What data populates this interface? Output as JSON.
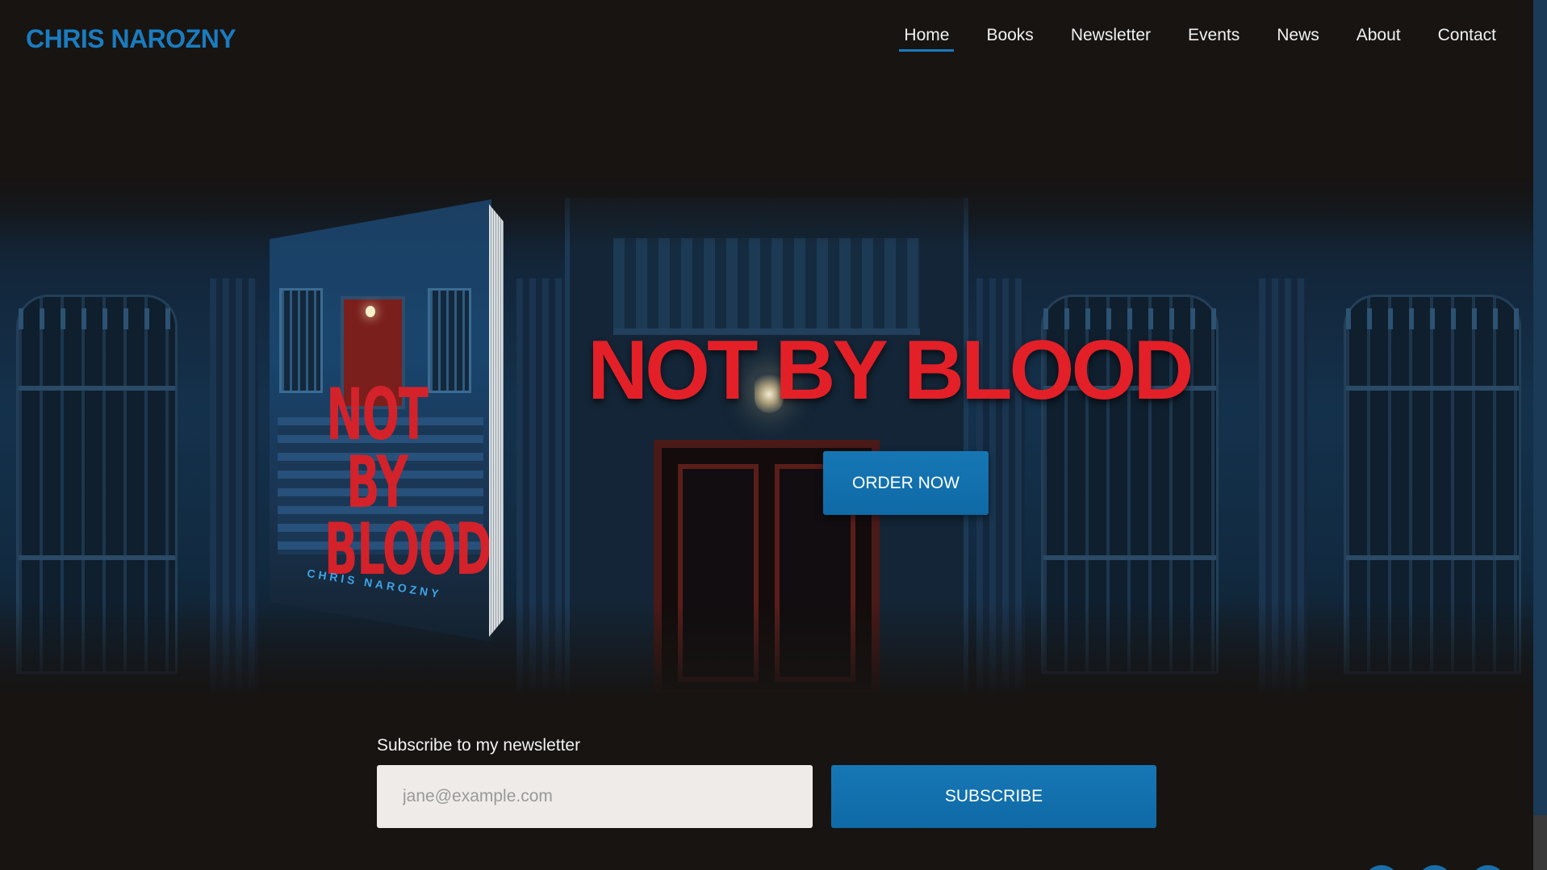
{
  "header": {
    "logo": "CHRIS NAROZNY",
    "nav": [
      {
        "label": "Home",
        "active": true
      },
      {
        "label": "Books"
      },
      {
        "label": "Newsletter"
      },
      {
        "label": "Events"
      },
      {
        "label": "News"
      },
      {
        "label": "About"
      },
      {
        "label": "Contact"
      }
    ]
  },
  "hero": {
    "title": "NOT BY BLOOD",
    "order_button": "ORDER NOW",
    "book": {
      "cover_title_lines": [
        "NOT",
        "BY",
        "BLOOD"
      ],
      "cover_author": "CHRIS NAROZNY"
    }
  },
  "newsletter": {
    "label": "Subscribe to my newsletter",
    "email_placeholder": "jane@example.com",
    "subscribe_button": "SUBSCRIBE"
  },
  "colors": {
    "brand_blue": "#1a7cbf",
    "title_red": "#e32028",
    "background": "#171412"
  },
  "icons": [
    "social-icon-1",
    "social-icon-2",
    "social-icon-3"
  ]
}
